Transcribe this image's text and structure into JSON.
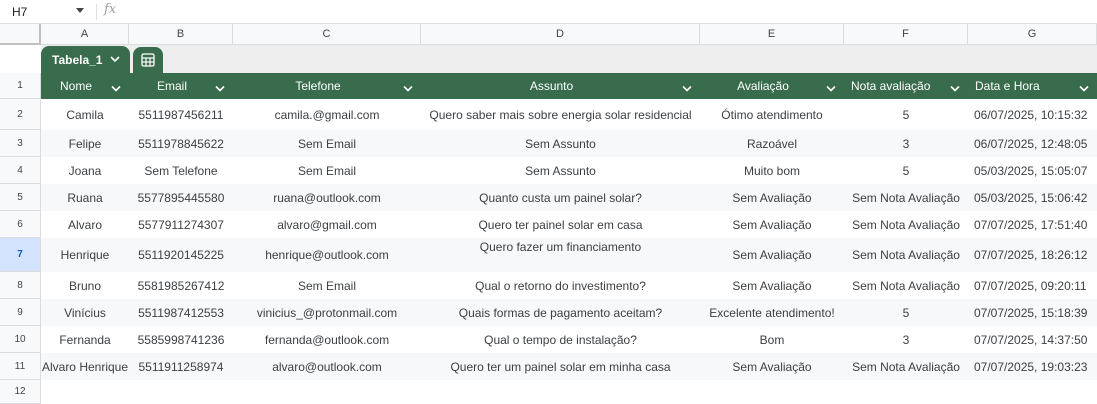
{
  "formula_bar": {
    "cell_ref": "H7",
    "fx": "fx"
  },
  "columns": [
    "A",
    "B",
    "C",
    "D",
    "E",
    "F",
    "G"
  ],
  "rows": [
    "1",
    "2",
    "3",
    "4",
    "5",
    "6",
    "7",
    "8",
    "9",
    "10",
    "11",
    "12"
  ],
  "active_row": "7",
  "table": {
    "name": "Tabela_1",
    "headers": [
      "Nome",
      "Email",
      "Telefone",
      "Assunto",
      "Avaliação",
      "Nota avaliação",
      "Data e Hora"
    ],
    "records": [
      [
        "Camila",
        "5511987456211",
        "camila.@gmail.com",
        "Quero saber mais sobre energia solar residencial",
        "Ótimo atendimento",
        "5",
        "06/07/2025, 10:15:32"
      ],
      [
        "Felipe",
        "5511978845622",
        "Sem Email",
        "Sem Assunto",
        "Razoável",
        "3",
        "06/07/2025, 12:48:05"
      ],
      [
        "Joana",
        "Sem Telefone",
        "Sem Email",
        "Sem Assunto",
        "Muito bom",
        "5",
        "05/03/2025, 15:05:07"
      ],
      [
        "Ruana",
        "5577895445580",
        "ruana@outlook.com",
        "Quanto custa um painel solar?",
        "Sem Avaliação",
        "Sem Nota Avaliação",
        "05/03/2025, 15:06:42"
      ],
      [
        "Alvaro",
        "5577911274307",
        "alvaro@gmail.com",
        "Quero ter painel solar em casa",
        "Sem Avaliação",
        "Sem Nota Avaliação",
        "07/07/2025, 17:51:40"
      ],
      [
        "Henrique",
        "5511920145225",
        "henrique@outlook.com",
        "Quero fazer um financiamento",
        "Sem Avaliação",
        "Sem Nota Avaliação",
        "07/07/2025, 18:26:12"
      ],
      [
        "Bruno",
        "5581985267412",
        "Sem Email",
        "Qual o retorno do investimento?",
        "Sem Avaliação",
        "Sem Nota Avaliação",
        "07/07/2025, 09:20:11"
      ],
      [
        "Vinícius",
        "5511987412553",
        "vinicius_@protonmail.com",
        "Quais formas de pagamento aceitam?",
        "Excelente atendimento!",
        "5",
        "07/07/2025, 15:18:39"
      ],
      [
        "Fernanda",
        "5585998741236",
        "fernanda@outlook.com",
        "Qual o tempo de instalação?",
        "Bom",
        "3",
        "07/07/2025, 14:37:50"
      ],
      [
        "Alvaro Henrique",
        "5511911258974",
        "alvaro@outlook.com",
        "Quero ter um painel solar em minha casa",
        "Sem Avaliação",
        "Sem Nota Avaliação",
        "07/07/2025, 19:03:23"
      ]
    ]
  },
  "colors": {
    "header_green": "#386c4c",
    "alt_row": "#f6f8f9",
    "active_row_bg": "#d3e3fd"
  },
  "icons": {
    "namebox_caret": "chevron-down-icon",
    "header_filter": "chevron-down-icon",
    "table_calc": "calculator-icon"
  }
}
